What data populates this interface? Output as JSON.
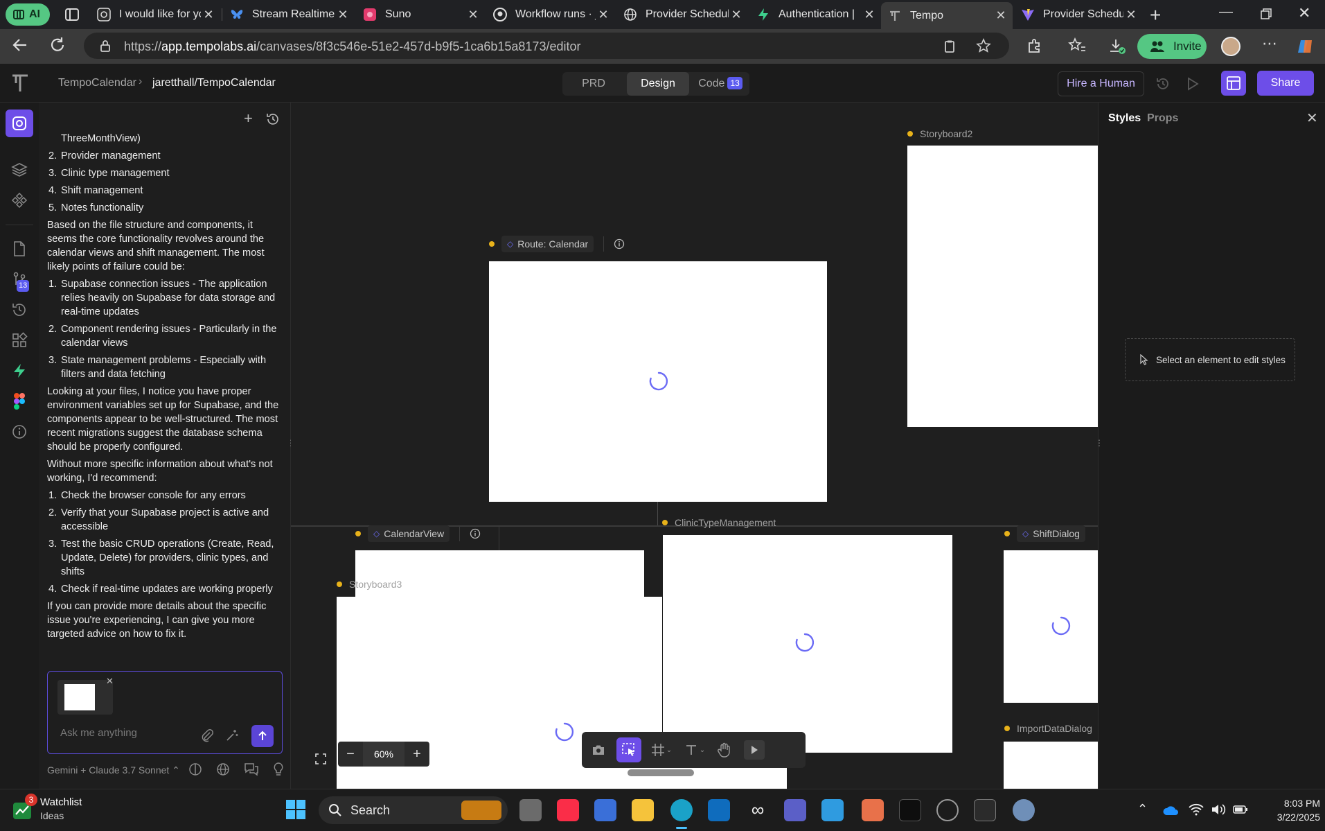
{
  "browser": {
    "tabs": [
      {
        "title": "I would like for yo",
        "icon": "chatgpt-icon"
      },
      {
        "title": "Stream Realtime",
        "icon": "bluesky-icon"
      },
      {
        "title": "Suno",
        "icon": "suno-icon"
      },
      {
        "title": "Workflow runs · ja",
        "icon": "github-icon"
      },
      {
        "title": "Provider Schedul",
        "icon": "globe-icon"
      },
      {
        "title": "Authentication |",
        "icon": "supabase-icon"
      },
      {
        "title": "Tempo",
        "icon": "tempo-icon",
        "active": true
      },
      {
        "title": "Provider Schedul",
        "icon": "vite-icon"
      }
    ],
    "profile_label": "AI",
    "url_prefix": "https://",
    "url_host": "app.tempolabs.ai",
    "url_path": "/canvases/8f3c546e-51e2-457d-b9f5-1ca6b15a8173/editor",
    "invite_label": "Invite",
    "accent": "#55c783"
  },
  "app": {
    "breadcrumb_project": "TempoCalendar",
    "breadcrumb_repo": "jaretthall/TempoCalendar",
    "modes": [
      "PRD",
      "Design",
      "Code"
    ],
    "selected_mode": "Design",
    "code_badge": "13",
    "hire_label": "Hire a Human",
    "share_label": "Share",
    "brand_color": "#6d4ee8",
    "rail_badge": "13"
  },
  "chat": {
    "lead_fragment": "ThreeMonthView)",
    "list1": [
      {
        "n": "2.",
        "text": "Provider management"
      },
      {
        "n": "3.",
        "text": "Clinic type management"
      },
      {
        "n": "4.",
        "text": "Shift management"
      },
      {
        "n": "5.",
        "text": "Notes functionality"
      }
    ],
    "para1": "Based on the file structure and components, it seems the core functionality revolves around the calendar views and shift management. The most likely points of failure could be:",
    "list2": [
      {
        "n": "1.",
        "text": "Supabase connection issues - The application relies heavily on Supabase for data storage and real-time updates"
      },
      {
        "n": "2.",
        "text": "Component rendering issues - Particularly in the calendar views"
      },
      {
        "n": "3.",
        "text": "State management problems - Especially with filters and data fetching"
      }
    ],
    "para2": "Looking at your files, I notice you have proper environment variables set up for Supabase, and the components appear to be well-structured. The most recent migrations suggest the database schema should be properly configured.",
    "para3": "Without more specific information about what's not working, I'd recommend:",
    "list3": [
      {
        "n": "1.",
        "text": "Check the browser console for any errors"
      },
      {
        "n": "2.",
        "text": "Verify that your Supabase project is active and accessible"
      },
      {
        "n": "3.",
        "text": "Test the basic CRUD operations (Create, Read, Update, Delete) for providers, clinic types, and shifts"
      },
      {
        "n": "4.",
        "text": "Check if real-time updates are working properly"
      }
    ],
    "para4": "If you can provide more details about the specific issue you're experiencing, I can give you more targeted advice on how to fix it.",
    "input_placeholder": "Ask me anything",
    "model_label": "Gemini + Claude 3.7 Sonnet"
  },
  "canvas": {
    "frames": {
      "storyboard2": "Storyboard2",
      "route_calendar": "Route: Calendar",
      "calendar_view": "CalendarView",
      "clinic_type": "ClinicTypeManagement",
      "shift_dialog": "ShiftDialog",
      "storyboard3": "Storyboard3",
      "import_dialog": "ImportDataDialog"
    },
    "zoom": "60%",
    "marker_color": "#e8b21a",
    "spinner_color": "#6b6bf5"
  },
  "styles_panel": {
    "tab_styles": "Styles",
    "tab_props": "Props",
    "empty_hint": "Select an element to edit styles"
  },
  "taskbar": {
    "widget_title": "Watchlist",
    "widget_sub": "Ideas",
    "widget_badge": "3",
    "search_label": "Search",
    "time": "8:03 PM",
    "date": "3/22/2025"
  }
}
